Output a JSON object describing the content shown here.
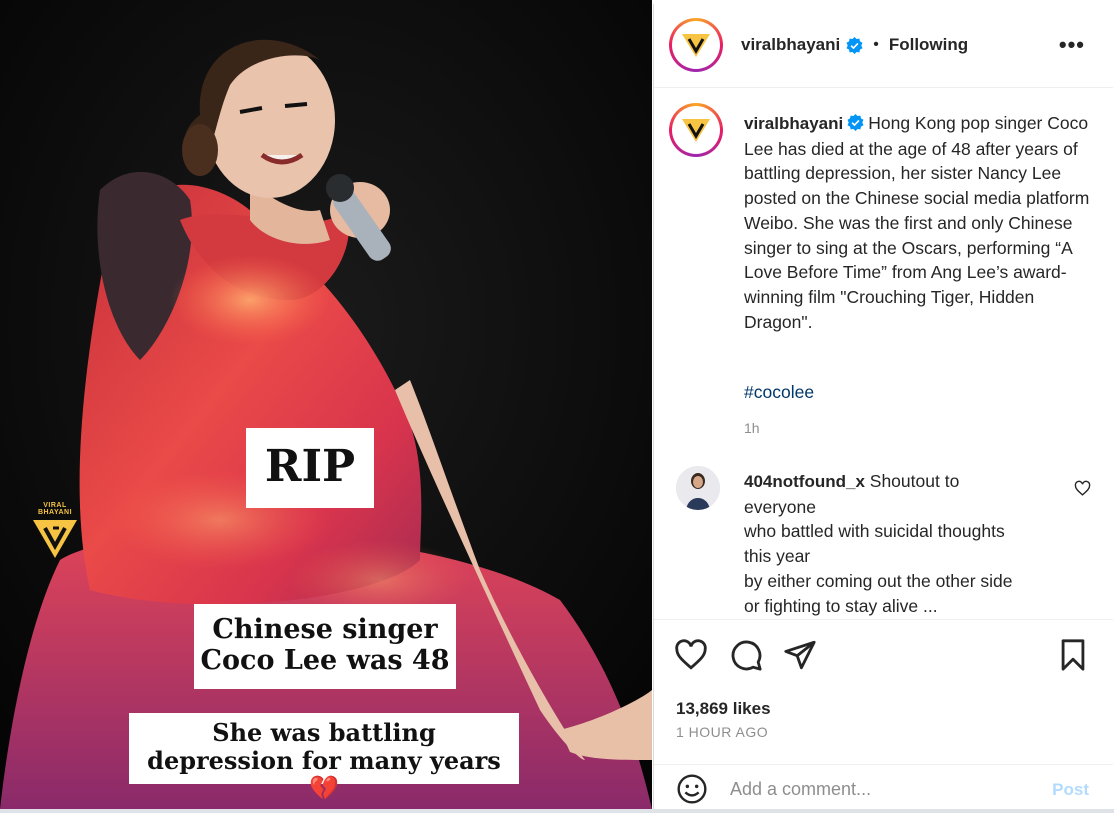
{
  "post": {
    "overlay_rip": "RIP",
    "overlay_singer_line1": "Chinese singer",
    "overlay_singer_line2": "Coco Lee was 48",
    "overlay_battling_line1": "She was battling",
    "overlay_battling_line2": "depression for many years",
    "overlay_battling_emoji": "💔",
    "watermark_text": "VIRAL BHAYANI"
  },
  "header": {
    "username": "viralbhayani",
    "separator": "•",
    "follow_state": "Following",
    "more_label": "•••"
  },
  "caption": {
    "username": "viralbhayani",
    "text": "Hong Kong pop singer Coco Lee has died at the age of 48 after years of battling depression, her sister Nancy Lee posted on the Chinese social media platform Weibo. She was the first and only Chinese singer to sing at the Oscars, performing “A Love Before Time” from Ang Lee’s award-winning film \"Crouching Tiger, Hidden Dragon\".",
    "hashtag": "#cocolee",
    "time_ago": "1h"
  },
  "comments": [
    {
      "username": "404notfound_x",
      "line1": "Shoutout to",
      "line2": "everyone",
      "line3": "who battled with suicidal thoughts",
      "line4": "this year",
      "line5": "by either coming out the other side",
      "line6": "or fighting to stay alive ..."
    }
  ],
  "stats": {
    "likes": "13,869 likes",
    "time": "1 HOUR AGO"
  },
  "comment_box": {
    "placeholder": "Add a comment...",
    "post_label": "Post"
  },
  "colors": {
    "brand_yellow": "#f6c342",
    "verified_blue": "#0095f6",
    "link_blue": "#00376b",
    "post_disabled": "#b3dbff"
  }
}
